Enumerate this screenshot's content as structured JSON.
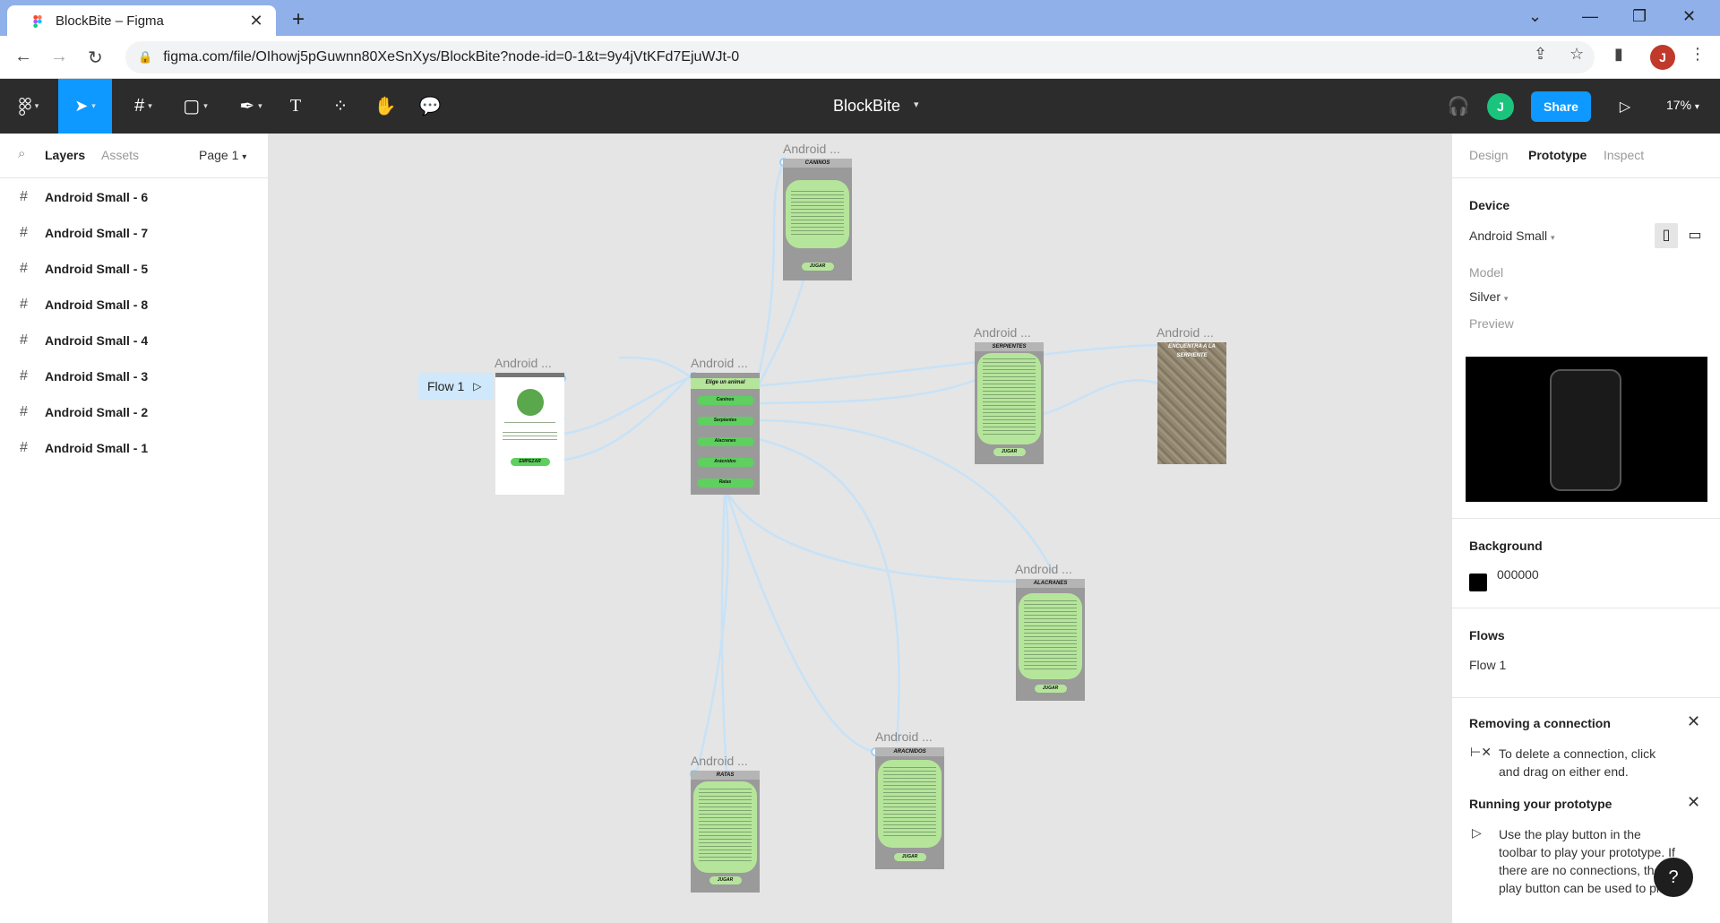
{
  "browser": {
    "tab_title": "BlockBite – Figma",
    "url": "figma.com/file/OIhowj5pGuwnn80XeSnXys/BlockBite?node-id=0-1&t=9y4jVtKFd7EjuWJt-0",
    "profile_initial": "J"
  },
  "toolbar": {
    "file_title": "BlockBite",
    "avatar_initial": "J",
    "share_label": "Share",
    "zoom": "17%"
  },
  "layers_panel": {
    "tab_layers": "Layers",
    "tab_assets": "Assets",
    "page": "Page 1",
    "layers": [
      "Android Small - 6",
      "Android Small - 7",
      "Android Small - 5",
      "Android Small - 8",
      "Android Small - 4",
      "Android Small - 3",
      "Android Small - 2",
      "Android Small - 1"
    ]
  },
  "canvas": {
    "flow_label": "Flow 1",
    "frame_label": "Android ...",
    "frames": {
      "caninos": {
        "title": "CANINOS",
        "button": "JUGAR"
      },
      "menu": {
        "title": "Elige un animal",
        "items": [
          "Caninos",
          "Serpientes",
          "Alacranes",
          "Arácnidos",
          "Ratas"
        ]
      },
      "start": {
        "button": "EMPEZAR"
      },
      "serpientes": {
        "title": "SERPIENTES",
        "button": "JUGAR"
      },
      "encuentra": {
        "title": "ENCUENTRA A LA SERPIENTE"
      },
      "alacranes": {
        "title": "ALACRANES",
        "button": "JUGAR"
      },
      "aracnidos": {
        "title": "ARACNIDOS",
        "button": "JUGAR"
      },
      "ratas": {
        "title": "RATAS",
        "button": "JUGAR"
      }
    }
  },
  "right_panel": {
    "tab_design": "Design",
    "tab_prototype": "Prototype",
    "tab_inspect": "Inspect",
    "device_heading": "Device",
    "device_value": "Android Small",
    "model_label": "Model",
    "model_value": "Silver",
    "preview_label": "Preview",
    "background_heading": "Background",
    "background_value": "000000",
    "flows_heading": "Flows",
    "flow_item": "Flow 1",
    "tip1_heading": "Removing a connection",
    "tip1_text": "To delete a connection, click and drag on either end.",
    "tip2_heading": "Running your prototype",
    "tip2_text": "Use the play button in the toolbar to play your prototype. If there are no connections, the play button can be used to play"
  },
  "colors": {
    "accent": "#0d99ff",
    "screen_green": "#b5e59b",
    "connection": "#c7e2f7"
  }
}
